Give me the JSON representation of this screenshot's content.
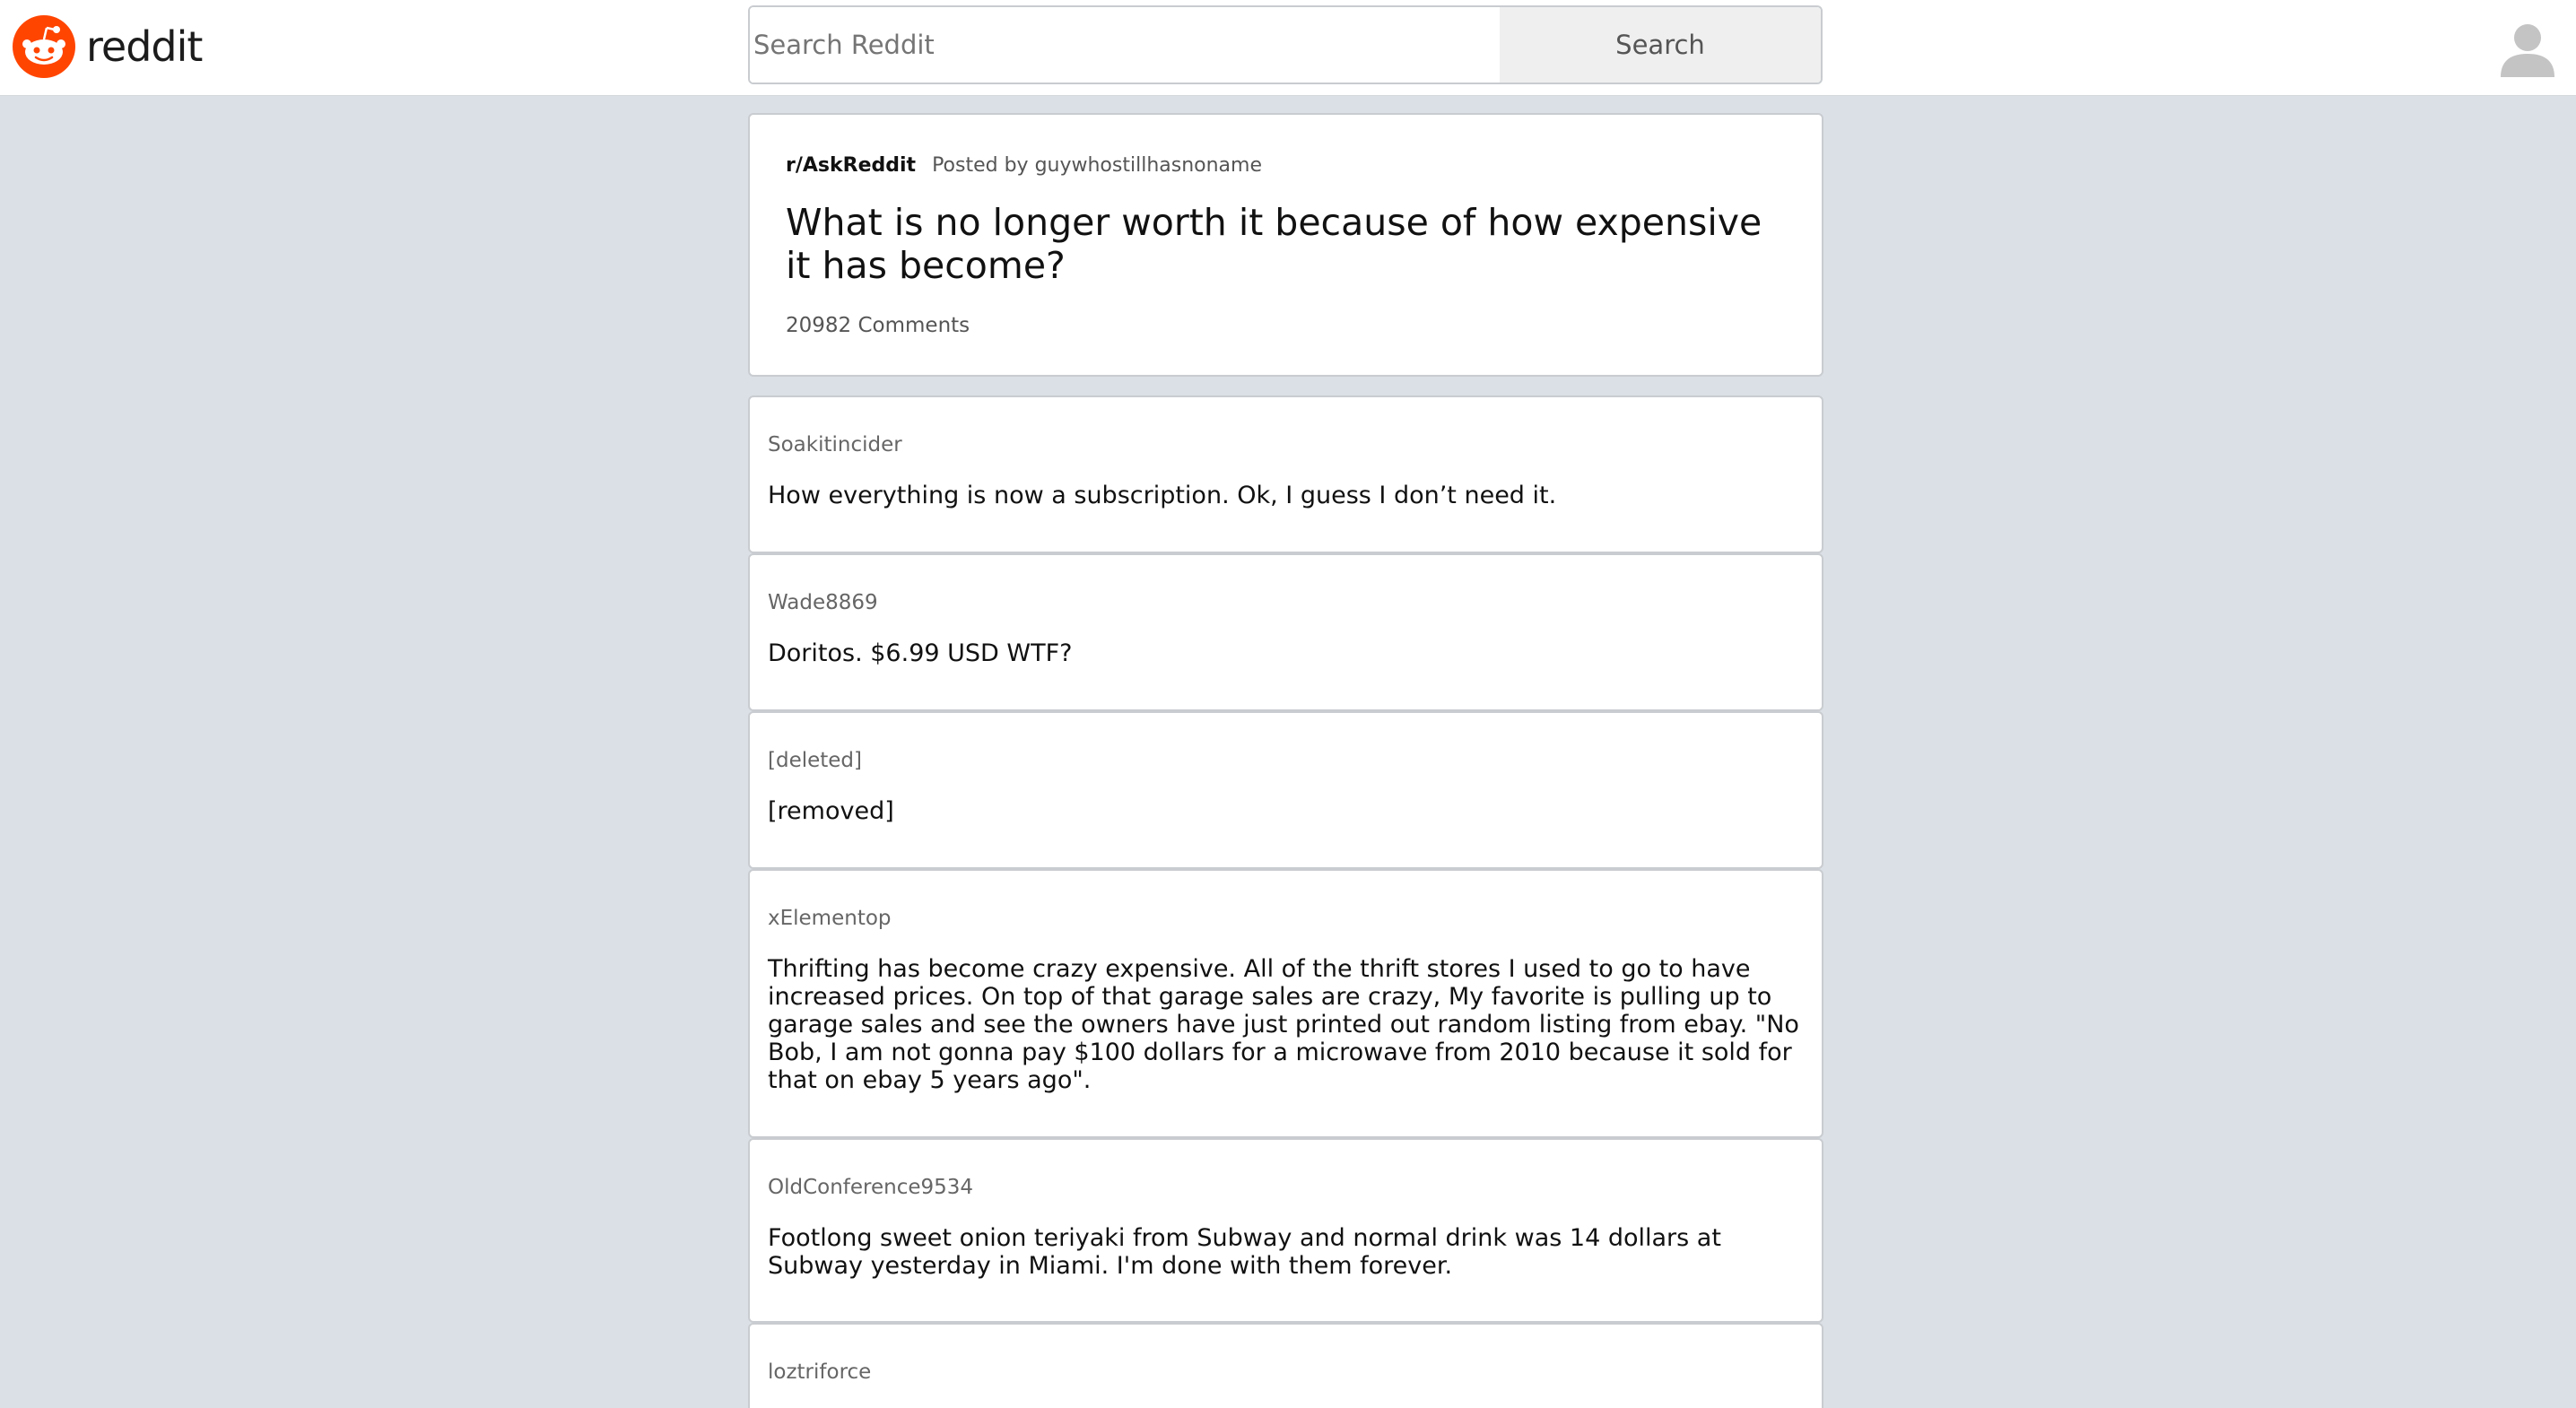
{
  "header": {
    "logo_text": "reddit",
    "search_placeholder": "Search Reddit",
    "search_button": "Search",
    "brand_color": "#ff4500"
  },
  "post": {
    "subreddit": "r/AskReddit",
    "posted_by": "Posted by guywhostillhasnoname",
    "title": "What is no longer worth it because of how expensive it has become?",
    "comments_count": "20982 Comments"
  },
  "comments": [
    {
      "author": "Soakitincider",
      "body": "How everything is now a subscription. Ok, I guess I don’t need it."
    },
    {
      "author": "Wade8869",
      "body": "Doritos. $6.99 USD WTF?"
    },
    {
      "author": "[deleted]",
      "body": "[removed]"
    },
    {
      "author": "xElementop",
      "body": "Thrifting has become crazy expensive. All of the thrift stores I used to go to have increased prices. On top of that garage sales are crazy, My favorite is pulling up to garage sales and see the owners have just printed out random listing from ebay. \"No Bob, I am not gonna pay $100 dollars for a microwave from 2010 because it sold for that on ebay 5 years ago\"."
    },
    {
      "author": "OldConference9534",
      "body": "Footlong sweet onion teriyaki from Subway and normal drink was 14 dollars at Subway yesterday in Miami. I'm done with them forever."
    },
    {
      "author": "loztriforce",
      "body": ""
    }
  ]
}
